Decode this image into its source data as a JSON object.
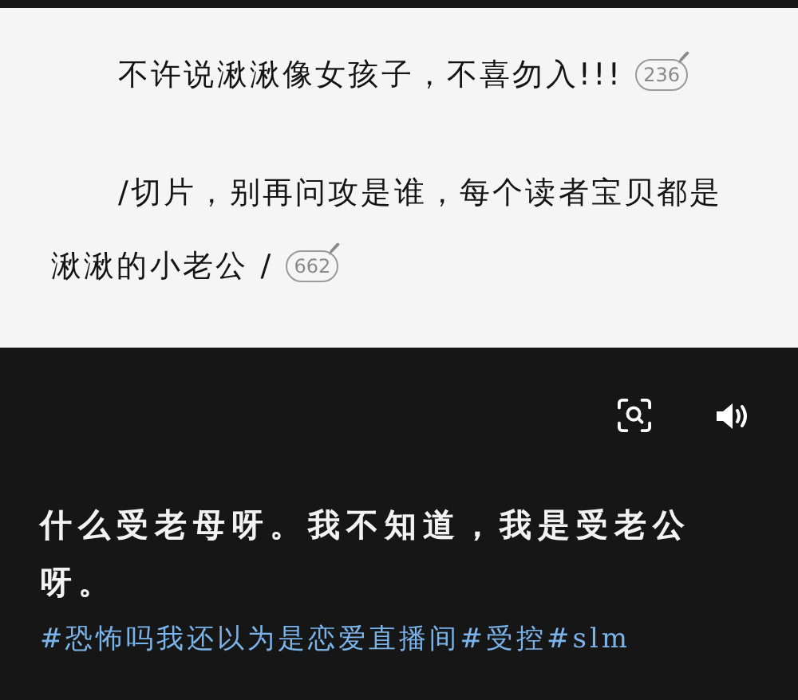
{
  "reader": {
    "paragraphs": [
      {
        "lines": [
          "不许说湫湫像女孩子，不喜勿入!!!"
        ],
        "comment_count": "236"
      },
      {
        "lines": [
          "/切片，别再问攻是谁，每个读者宝贝都是",
          "湫湫的小老公 /"
        ],
        "comment_count": "662"
      }
    ]
  },
  "video": {
    "caption": "什么受老母呀。我不知道，我是受老公呀。",
    "hashtags": [
      "#恐怖吗我还以为是恋爱直播间",
      "#受控",
      "#slm"
    ]
  }
}
